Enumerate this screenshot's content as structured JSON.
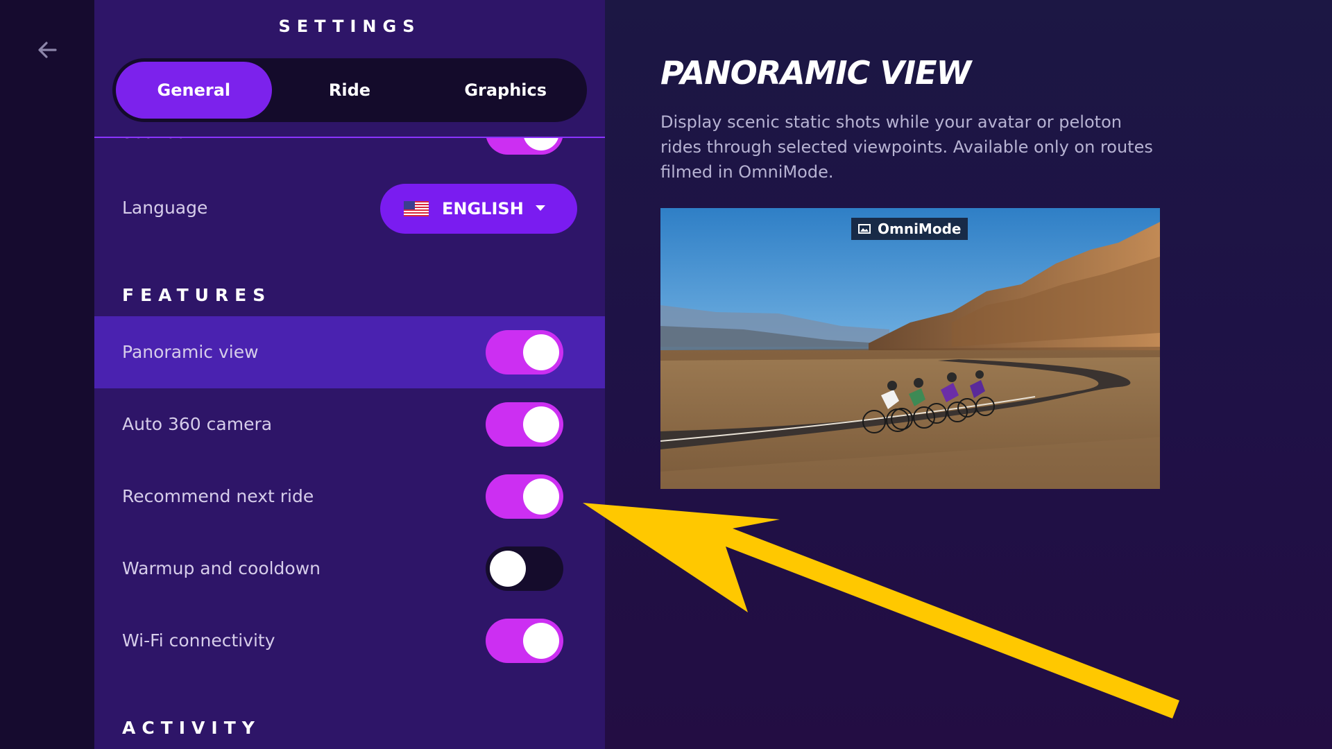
{
  "settings": {
    "title": "SETTINGS",
    "tabs": [
      {
        "label": "General",
        "active": true
      },
      {
        "label": "Ride",
        "active": false
      },
      {
        "label": "Graphics",
        "active": false
      }
    ],
    "sounds_label": "Sounds",
    "language": {
      "label": "Language",
      "value": "ENGLISH",
      "flag_icon": "us-flag-icon"
    },
    "features_heading": "FEATURES",
    "features": [
      {
        "label": "Panoramic view",
        "enabled": true,
        "selected": true
      },
      {
        "label": "Auto 360 camera",
        "enabled": true
      },
      {
        "label": "Recommend next ride",
        "enabled": true
      },
      {
        "label": "Warmup and cooldown",
        "enabled": false
      },
      {
        "label": "Wi-Fi connectivity",
        "enabled": true
      }
    ],
    "activity_heading": "ACTIVITY"
  },
  "detail": {
    "title": "PANORAMIC VIEW",
    "description": "Display scenic static shots while your avatar or peloton rides through selected viewpoints. Available only on routes filmed in OmniMode.",
    "badge": "OmniMode",
    "image_icon": "image-icon"
  },
  "colors": {
    "accent": "#7c22ec",
    "toggle_on": "#cc2ff2",
    "panel": "#2e1568",
    "annotation_arrow": "#ffc800"
  }
}
